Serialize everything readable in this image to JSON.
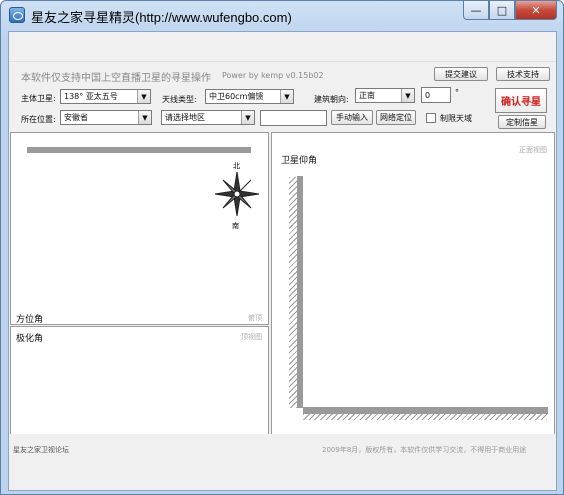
{
  "window": {
    "title": "星友之家寻星精灵(http://www.wufengbo.com)",
    "buttons": {
      "minimize": "—",
      "maximize": "□",
      "close": "✕"
    }
  },
  "header": {
    "description": "本软件仅支持中国上空直播卫星的寻星操作",
    "powered_by": "Power by kemp  v0.15b02",
    "feedback_button": "提交建议",
    "support_button": "技术支持"
  },
  "form": {
    "satellite_label": "主体卫星:",
    "satellite_value": "138°    亚太五号",
    "antenna_label": "天线类型:",
    "antenna_value": "中卫60cm偏馈",
    "direction_label": "建筑朝向:",
    "direction_value": "正南",
    "angle_value": "0",
    "angle_unit": "°",
    "location_label": "所在位置:",
    "province_value": "安徽省",
    "region_value": "请选择地区",
    "city_input_value": "",
    "manual_input_button": "手动输入",
    "network_locate_button": "网络定位",
    "limit_sky_label": "制限天域",
    "confirm_button": "确认寻星",
    "customize_button": "定制信星"
  },
  "panels": {
    "azimuth": {
      "title": "方位角",
      "subtitle": "俯顶",
      "north": "北",
      "south": "南"
    },
    "polarization": {
      "title": "极化角",
      "subtitle": "顶视图"
    },
    "elevation": {
      "title": "卫星仰角",
      "subtitle": "正面视图"
    }
  },
  "status": {
    "left": "星友之家卫视论坛",
    "right": "2009年8月，版权所有，本软件仅供学习交流，不得用于商业用途"
  },
  "colors": {
    "confirm_text": "#d02020",
    "bar": "#9a9a9a"
  }
}
